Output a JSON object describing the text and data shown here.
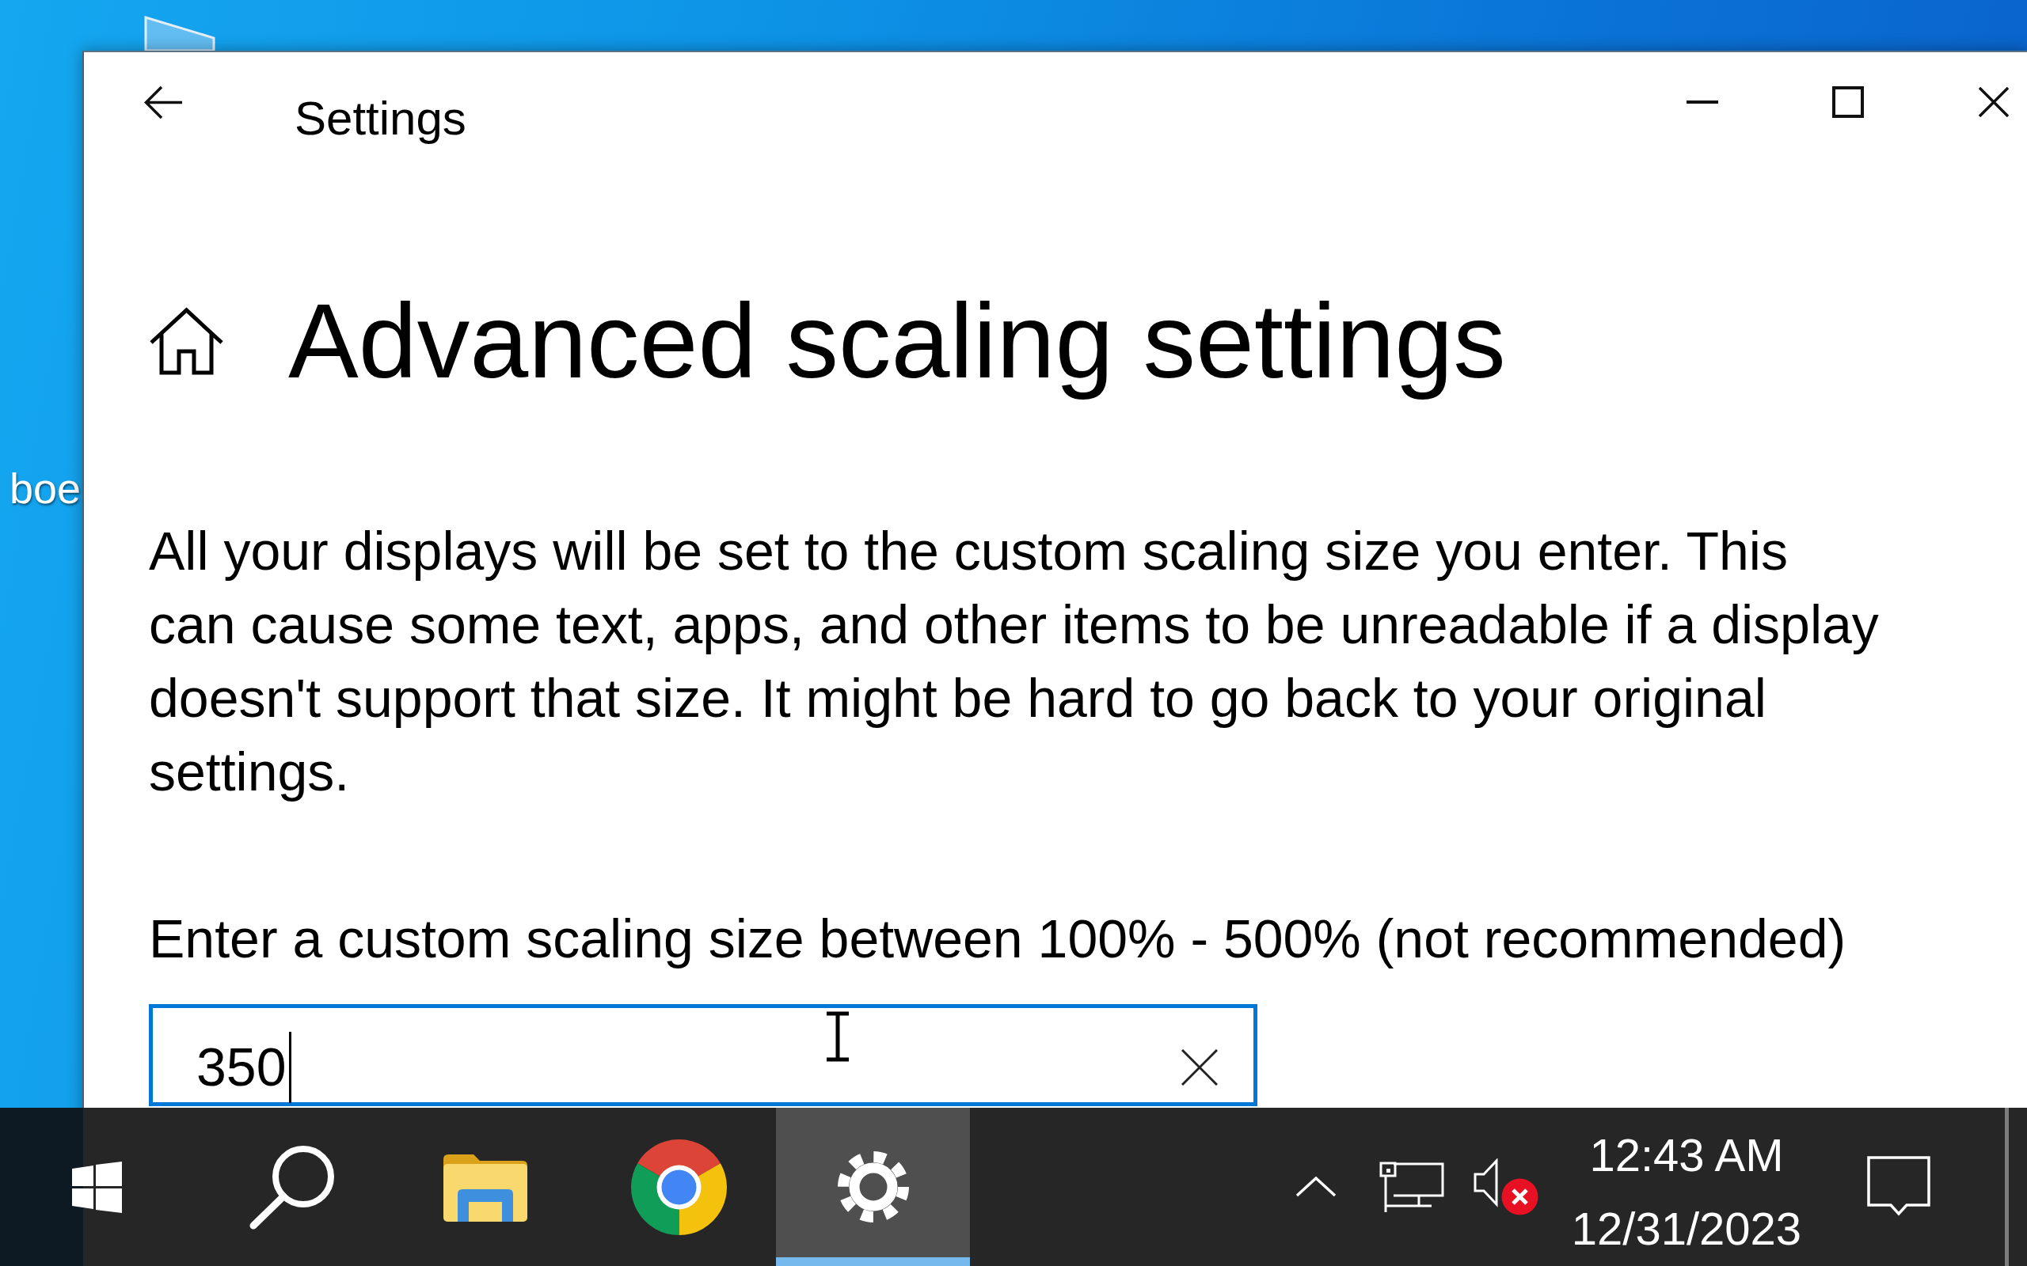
{
  "desktop": {
    "icon_label": "boe"
  },
  "window": {
    "title": "Settings"
  },
  "page": {
    "heading": "Advanced scaling settings",
    "description": "All your displays will be set to the custom scaling size you enter. This can cause some text, apps, and other items to be unreadable if a display doesn't support that size. It might be hard to go back to your original settings.",
    "field_label": "Enter a custom scaling size between 100% - 500% (not recommended)",
    "field": {
      "value": "350",
      "focused": true
    }
  },
  "taskbar": {
    "apps": [
      {
        "kind": "file_explorer",
        "selected": false
      },
      {
        "kind": "chrome",
        "selected": false
      },
      {
        "kind": "settings",
        "selected": true
      }
    ],
    "tray": {
      "volume_muted": true
    },
    "clock": {
      "time": "12:43 AM",
      "date": "12/31/2023"
    }
  }
}
